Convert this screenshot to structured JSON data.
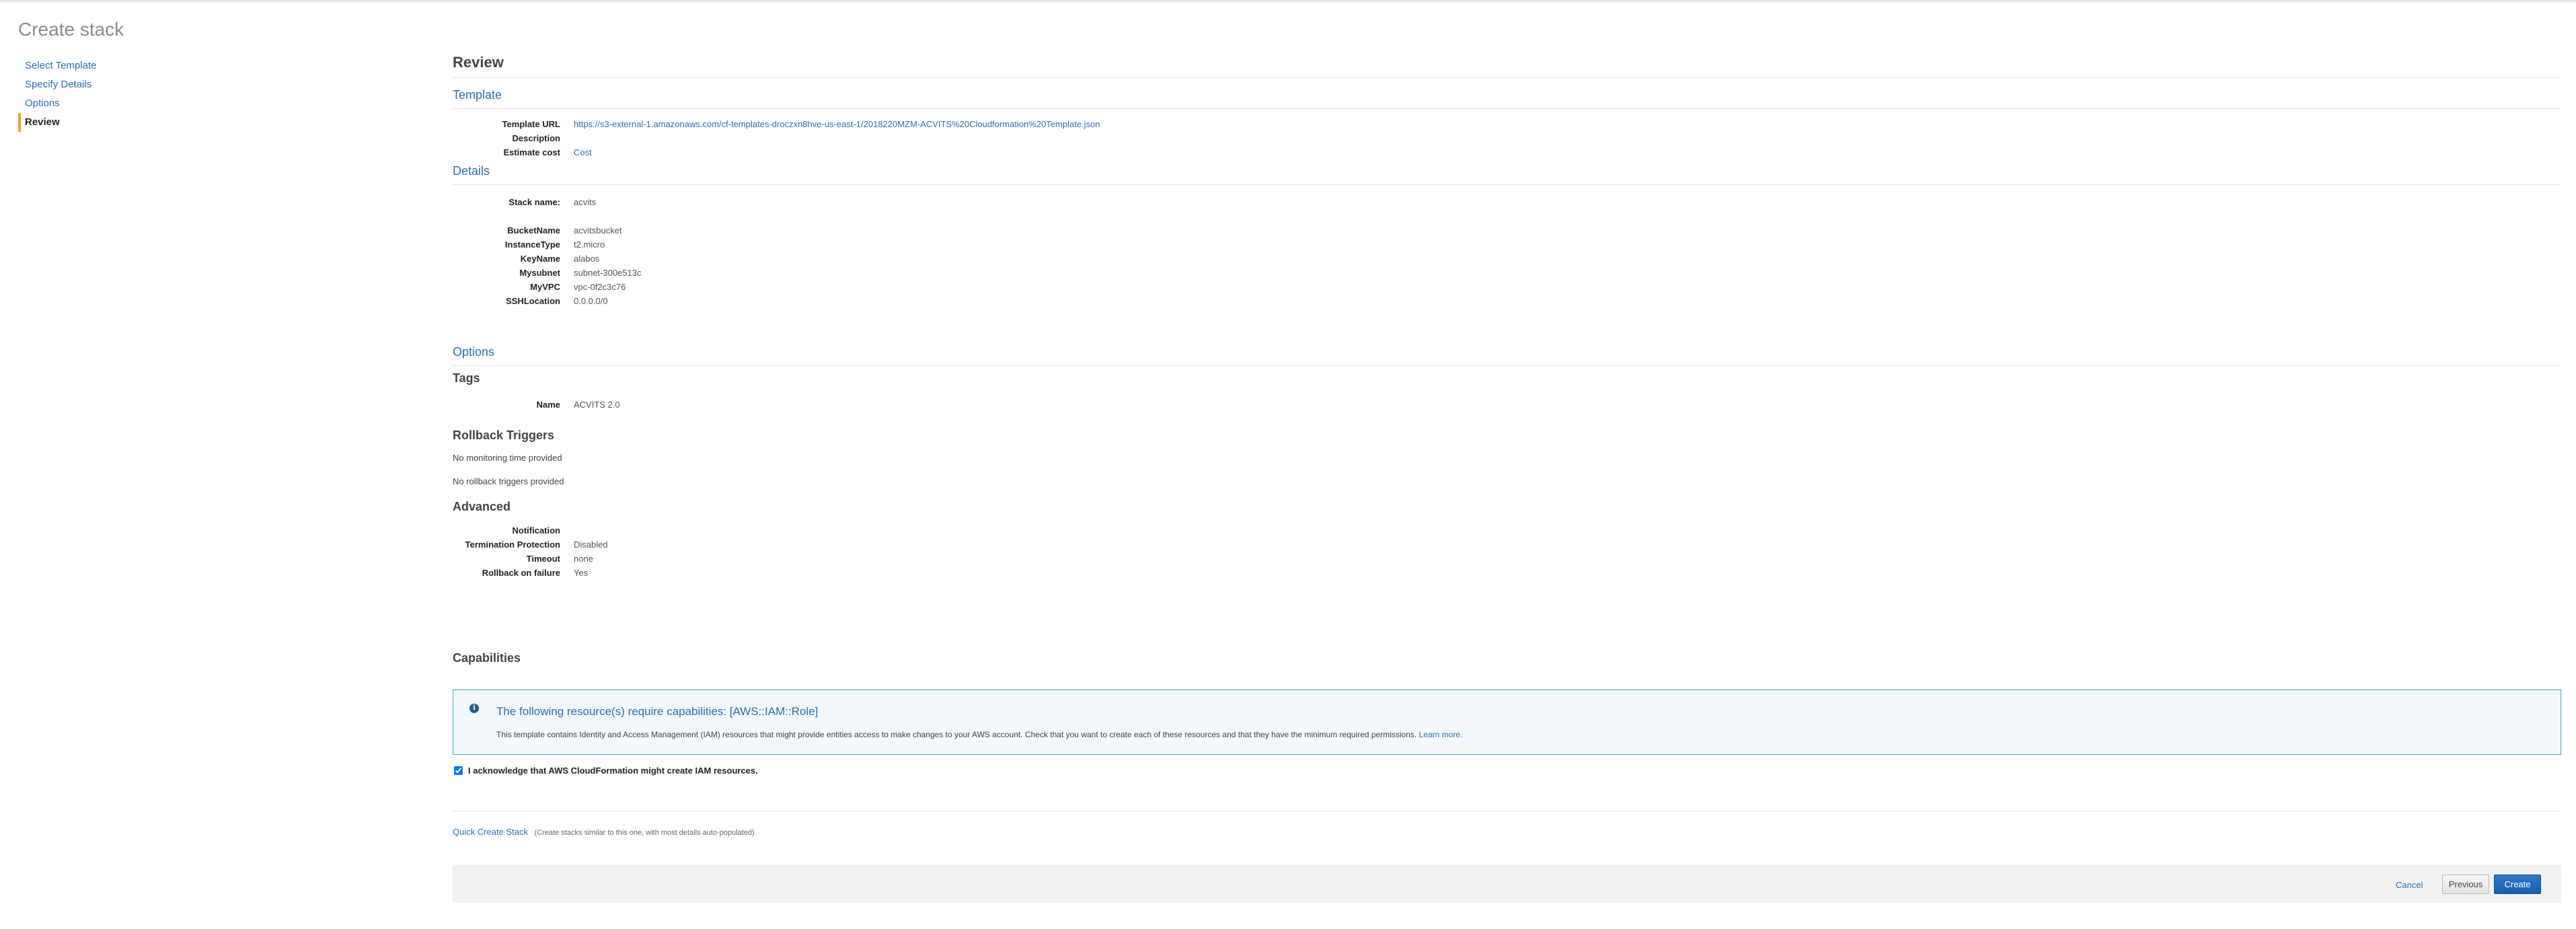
{
  "page": {
    "title": "Create stack"
  },
  "steps": [
    {
      "label": "Select Template"
    },
    {
      "label": "Specify Details"
    },
    {
      "label": "Options"
    },
    {
      "label": "Review"
    }
  ],
  "review": {
    "heading": "Review",
    "template": {
      "section_title": "Template",
      "url_label": "Template URL",
      "url": "https://s3-external-1.amazonaws.com/cf-templates-droczxn8hve-us-east-1/2018220MZM-ACVITS%20Cloudformation%20Template.json",
      "description_label": "Description",
      "description": "",
      "cost_label": "Estimate cost",
      "cost_link": "Cost"
    },
    "details": {
      "section_title": "Details",
      "stack_name_label": "Stack name:",
      "stack_name": "acvits",
      "params": [
        {
          "key": "BucketName",
          "value": "acvitsbucket"
        },
        {
          "key": "InstanceType",
          "value": "t2.micro"
        },
        {
          "key": "KeyName",
          "value": "alabos"
        },
        {
          "key": "Mysubnet",
          "value": "subnet-300e513c"
        },
        {
          "key": "MyVPC",
          "value": "vpc-0f2c3c76"
        },
        {
          "key": "SSHLocation",
          "value": "0.0.0.0/0"
        }
      ]
    },
    "options": {
      "section_title": "Options",
      "tags_title": "Tags",
      "tag_name_label": "Name",
      "tag_name_value": "ACVITS 2.0",
      "rollback_title": "Rollback Triggers",
      "no_monitoring": "No monitoring time provided",
      "no_triggers": "No rollback triggers provided",
      "advanced_title": "Advanced",
      "advanced": [
        {
          "key": "Notification",
          "value": ""
        },
        {
          "key": "Termination Protection",
          "value": "Disabled"
        },
        {
          "key": "Timeout",
          "value": "none"
        },
        {
          "key": "Rollback on failure",
          "value": "Yes"
        }
      ]
    },
    "capabilities": {
      "title": "Capabilities",
      "info_title": "The following resource(s) require capabilities: [AWS::IAM::Role]",
      "info_desc": "This template contains Identity and Access Management (IAM) resources that might provide entities access to make changes to your AWS account. Check that you want to create each of these resources and that they have the minimum required permissions.",
      "learn_more": "Learn more.",
      "ack_label": "I acknowledge that AWS CloudFormation might create IAM resources.",
      "ack_checked": true
    },
    "quick_create": {
      "link": "Quick Create Stack",
      "hint": "(Create stacks similar to this one, with most details auto-populated)"
    }
  },
  "footer": {
    "cancel": "Cancel",
    "previous": "Previous",
    "create": "Create"
  }
}
